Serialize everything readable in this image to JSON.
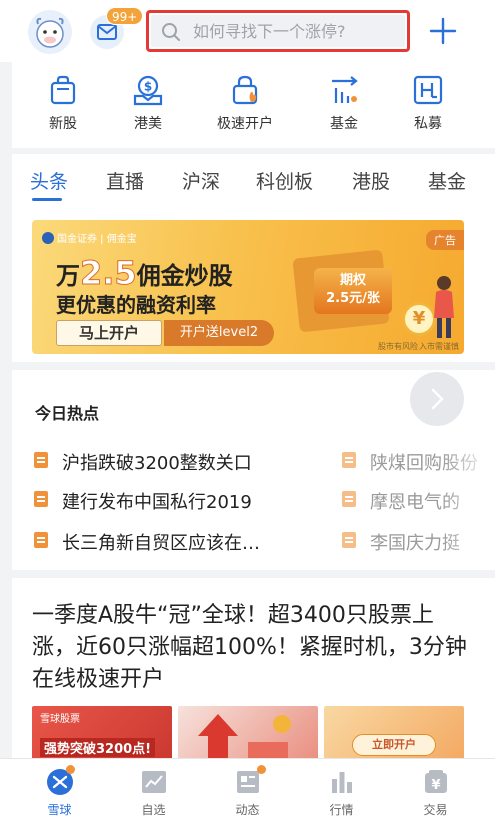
{
  "header": {
    "mail_badge": "99+",
    "search_placeholder": "如何寻找下一个涨停?",
    "highlight_color": "#e53935"
  },
  "quick_entries": [
    {
      "label": "新股",
      "icon": "bag-icon"
    },
    {
      "label": "港美",
      "icon": "dollar-icon"
    },
    {
      "label": "极速开户",
      "icon": "fast-account-icon"
    },
    {
      "label": "基金",
      "icon": "fund-icon"
    },
    {
      "label": "私募",
      "icon": "private-fund-icon"
    }
  ],
  "tabs": [
    "头条",
    "直播",
    "沪深",
    "科创板",
    "港股",
    "基金"
  ],
  "active_tab": "头条",
  "banner": {
    "brand": "国金证券 | 佣金宝",
    "ad_label": "广告",
    "title_prefix": "万",
    "title_number": "2.5",
    "title_suffix": "佣金炒股",
    "subtitle": "更优惠的融资利率",
    "cta": "马上开户",
    "cta_secondary": "开户送level2",
    "tag_line1": "期权",
    "tag_line2": "2.5元/张",
    "fine_print_1": "股市有风险",
    "fine_print_2": "入市需谨慎",
    "coin_symbol": "¥",
    "slide_count": 6,
    "active_slide": 1
  },
  "hot_topics": {
    "title": "今日热点",
    "left": [
      "沪指跌破3200整数关口",
      "建行发布中国私行2019",
      "长三角新自贸区应该在…"
    ],
    "right": [
      "陕煤回购股份",
      "摩恩电气的",
      "李国庆力挺"
    ]
  },
  "article": {
    "title": "一季度A股牛“冠”全球！超3400只股票上涨，近60只涨幅超100%！紧握时机，3分钟在线极速开户",
    "thumb1_brand": "雪球股票",
    "thumb1_text": "强势突破3200点!",
    "thumb3_button": "立即开户"
  },
  "tabbar": [
    {
      "label": "雪球",
      "icon": "snowball-icon",
      "active": true
    },
    {
      "label": "自选",
      "icon": "watchlist-icon",
      "active": false
    },
    {
      "label": "动态",
      "icon": "feed-icon",
      "active": false
    },
    {
      "label": "行情",
      "icon": "market-icon",
      "active": false
    },
    {
      "label": "交易",
      "icon": "trade-icon",
      "active": false
    }
  ],
  "colors": {
    "accent": "#2a70d8",
    "orange": "#f0923a"
  }
}
